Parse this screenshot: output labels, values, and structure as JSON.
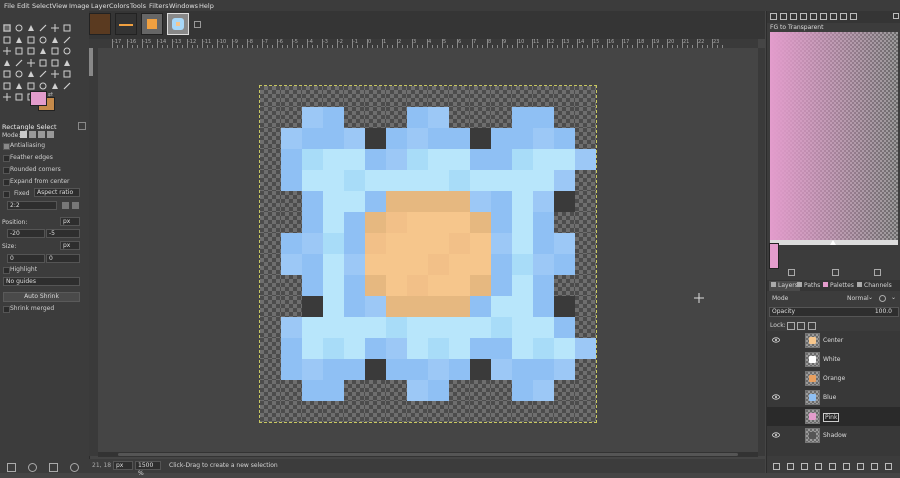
{
  "menu": [
    "File",
    "Edit",
    "Select",
    "View",
    "Image",
    "Layer",
    "Colors",
    "Tools",
    "Filters",
    "Windows",
    "Help"
  ],
  "tool_options": {
    "title": "Rectangle Select",
    "mode_label": "Mode:",
    "antialiasing": "Antialiasing",
    "feather_edges": "Feather edges",
    "rounded_corners": "Rounded corners",
    "expand_from_center": "Expand from center",
    "fixed_label": "Fixed",
    "fixed_value": "Aspect ratio",
    "ratio_value": "2:2",
    "position_label": "Position:",
    "position_unit": "px",
    "position_x": "-20",
    "position_y": "-5",
    "size_label": "Size:",
    "size_unit": "px",
    "size_w": "0",
    "size_h": "0",
    "highlight": "Highlight",
    "guides_value": "No guides",
    "auto_shrink": "Auto Shrink",
    "shrink_merged": "Shrink merged"
  },
  "ruler_labels": [
    "-17",
    "-16",
    "-15",
    "-14",
    "-13",
    "-12",
    "-11",
    "-10",
    "-9",
    "-8",
    "-7",
    "-6",
    "-5",
    "-4",
    "-3",
    "-2",
    "-1",
    "0",
    "1",
    "2",
    "3",
    "4",
    "5",
    "6",
    "7",
    "8",
    "9",
    "10",
    "11",
    "12",
    "13",
    "14",
    "15",
    "16",
    "17",
    "18",
    "19",
    "20",
    "21",
    "22",
    "23"
  ],
  "status": {
    "coords": "21, 18",
    "unit": "px",
    "zoom": "1500 %",
    "message": "Click-Drag to create a new selection"
  },
  "gradient": {
    "name": "FG to Transparent"
  },
  "dock_tabs": [
    "Layers",
    "Paths",
    "Palettes",
    "Channels"
  ],
  "layers_panel": {
    "mode_label": "Mode",
    "mode_value": "Normal",
    "opacity_label": "Opacity",
    "opacity_value": "100.0",
    "lock_label": "Lock:"
  },
  "layers": [
    {
      "name": "Center",
      "visible": true,
      "color": "#f6c68c"
    },
    {
      "name": "White",
      "visible": false,
      "color": "#ffffff"
    },
    {
      "name": "Orange",
      "visible": false,
      "color": "#e8a060"
    },
    {
      "name": "Blue",
      "visible": true,
      "color": "#8fc0f4"
    },
    {
      "name": "Pink",
      "visible": false,
      "color": "#e39ccc",
      "selected": true
    },
    {
      "name": "Shadow",
      "visible": true,
      "color": "#555555"
    }
  ],
  "colors": {
    "fg": "#e39ccc",
    "bg": "#c58a4a",
    "accent": "#e39ccc"
  }
}
